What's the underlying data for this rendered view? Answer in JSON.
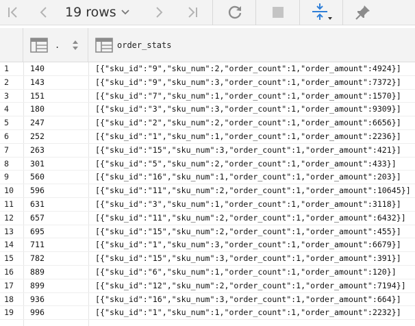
{
  "toolbar": {
    "rows_label": "19 rows",
    "icons": [
      "first-page-icon",
      "prev-page-icon",
      "rows-dropdown-icon",
      "next-page-icon",
      "last-page-icon",
      "refresh-icon",
      "stop-icon",
      "compare-icon",
      "pin-icon"
    ]
  },
  "columns": [
    {
      "name": ".",
      "icon": "table-column-icon",
      "sort_icon": "sort-icon"
    },
    {
      "name": "order_stats",
      "icon": "table-column-icon"
    }
  ],
  "rows": [
    {
      "num": "1",
      "id": "140",
      "stats": "[{\"sku_id\":\"9\",\"sku_num\":2,\"order_count\":1,\"order_amount\":4924}]"
    },
    {
      "num": "2",
      "id": "143",
      "stats": "[{\"sku_id\":\"9\",\"sku_num\":3,\"order_count\":1,\"order_amount\":7372}]"
    },
    {
      "num": "3",
      "id": "151",
      "stats": "[{\"sku_id\":\"7\",\"sku_num\":1,\"order_count\":1,\"order_amount\":1570}]"
    },
    {
      "num": "4",
      "id": "180",
      "stats": "[{\"sku_id\":\"3\",\"sku_num\":3,\"order_count\":1,\"order_amount\":9309}]"
    },
    {
      "num": "5",
      "id": "247",
      "stats": "[{\"sku_id\":\"2\",\"sku_num\":2,\"order_count\":1,\"order_amount\":6656}]"
    },
    {
      "num": "6",
      "id": "252",
      "stats": "[{\"sku_id\":\"1\",\"sku_num\":1,\"order_count\":1,\"order_amount\":2236}]"
    },
    {
      "num": "7",
      "id": "263",
      "stats": "[{\"sku_id\":\"15\",\"sku_num\":3,\"order_count\":1,\"order_amount\":421}]"
    },
    {
      "num": "8",
      "id": "301",
      "stats": "[{\"sku_id\":\"5\",\"sku_num\":2,\"order_count\":1,\"order_amount\":433}]"
    },
    {
      "num": "9",
      "id": "560",
      "stats": "[{\"sku_id\":\"16\",\"sku_num\":1,\"order_count\":1,\"order_amount\":203}]"
    },
    {
      "num": "10",
      "id": "596",
      "stats": "[{\"sku_id\":\"11\",\"sku_num\":2,\"order_count\":1,\"order_amount\":10645}]"
    },
    {
      "num": "11",
      "id": "631",
      "stats": "[{\"sku_id\":\"3\",\"sku_num\":1,\"order_count\":1,\"order_amount\":3118}]"
    },
    {
      "num": "12",
      "id": "657",
      "stats": "[{\"sku_id\":\"11\",\"sku_num\":2,\"order_count\":1,\"order_amount\":6432}]"
    },
    {
      "num": "13",
      "id": "695",
      "stats": "[{\"sku_id\":\"15\",\"sku_num\":2,\"order_count\":1,\"order_amount\":455}]"
    },
    {
      "num": "14",
      "id": "711",
      "stats": "[{\"sku_id\":\"1\",\"sku_num\":3,\"order_count\":1,\"order_amount\":6679}]"
    },
    {
      "num": "15",
      "id": "782",
      "stats": "[{\"sku_id\":\"15\",\"sku_num\":3,\"order_count\":1,\"order_amount\":391}]"
    },
    {
      "num": "16",
      "id": "889",
      "stats": "[{\"sku_id\":\"6\",\"sku_num\":1,\"order_count\":1,\"order_amount\":120}]"
    },
    {
      "num": "17",
      "id": "899",
      "stats": "[{\"sku_id\":\"12\",\"sku_num\":2,\"order_count\":1,\"order_amount\":7194}]"
    },
    {
      "num": "18",
      "id": "936",
      "stats": "[{\"sku_id\":\"16\",\"sku_num\":3,\"order_count\":1,\"order_amount\":664}]"
    },
    {
      "num": "19",
      "id": "996",
      "stats": "[{\"sku_id\":\"1\",\"sku_num\":1,\"order_count\":1,\"order_amount\":2232}]"
    }
  ],
  "colors": {
    "toolbar_bg": "#f3f3f3",
    "icon_gray": "#9a9a9a",
    "accent_blue": "#2f7fd8",
    "text": "#111111"
  }
}
